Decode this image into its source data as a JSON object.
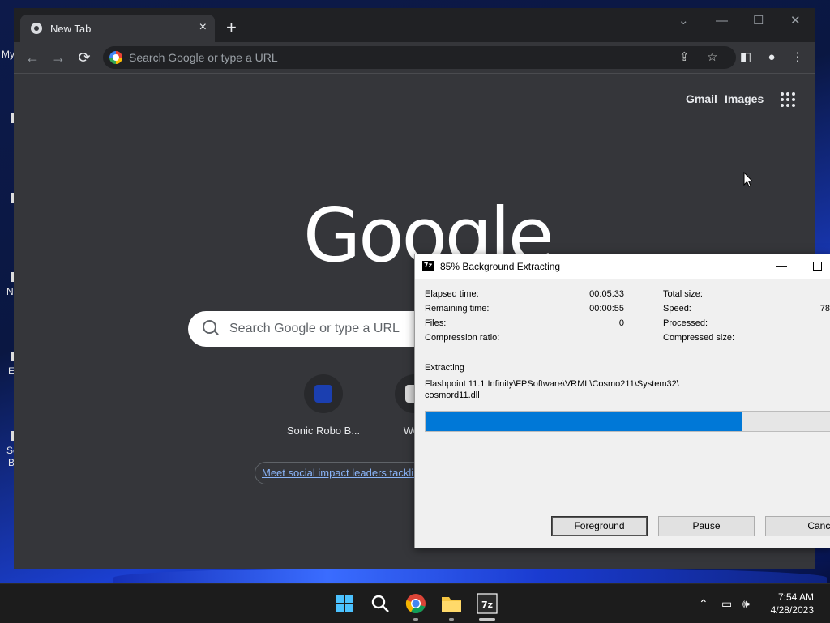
{
  "desktop": {
    "fragments": [
      "My",
      "N",
      "E",
      "Sc",
      "B"
    ]
  },
  "browser": {
    "tab_title": "New Tab",
    "tab_close": "×",
    "new_tab": "+",
    "window_controls": [
      "⌄",
      "—",
      "☐",
      "✕"
    ],
    "omnibox_placeholder": "Search Google or type a URL",
    "links": [
      "Gmail",
      "Images"
    ],
    "logo": "Google",
    "search_placeholder": "Search Google or type a URL",
    "shortcuts": [
      {
        "label": "Sonic Robo B...",
        "color": "#1b3fb0"
      },
      {
        "label": "Web",
        "color": "#d9d9d9"
      }
    ],
    "promo_text": "Meet social impact leaders tackling"
  },
  "dialog": {
    "title": "85% Background Extracting",
    "logo": "7z",
    "fields_left": [
      {
        "label": "Elapsed time:",
        "value": "00:05:33"
      },
      {
        "label": "Remaining time:",
        "value": "00:00:55"
      },
      {
        "label": "Files:",
        "value": "0"
      },
      {
        "label": "Compression ratio:",
        "value": ""
      }
    ],
    "fields_right": [
      {
        "label": "Total size:",
        "value": ""
      },
      {
        "label": "Speed:",
        "value": "78"
      },
      {
        "label": "Processed:",
        "value": ""
      },
      {
        "label": "Compressed size:",
        "value": ""
      }
    ],
    "status": "Extracting",
    "path_line1": "Flashpoint 11.1 Infinity\\FPSoftware\\VRML\\Cosmo211\\System32\\",
    "path_line2": "cosmord11.dll",
    "progress": 0.85,
    "buttons": [
      "Foreground",
      "Pause",
      "Cancel"
    ]
  },
  "taskbar": {
    "time": "7:54 AM",
    "date": "4/28/2023",
    "apps": [
      "start",
      "search",
      "chrome",
      "file-explorer",
      "7zip"
    ]
  },
  "colors": {
    "accent": "#0078d7",
    "chrome_bg": "#35363a",
    "link_blue": "#8ab4f8"
  }
}
